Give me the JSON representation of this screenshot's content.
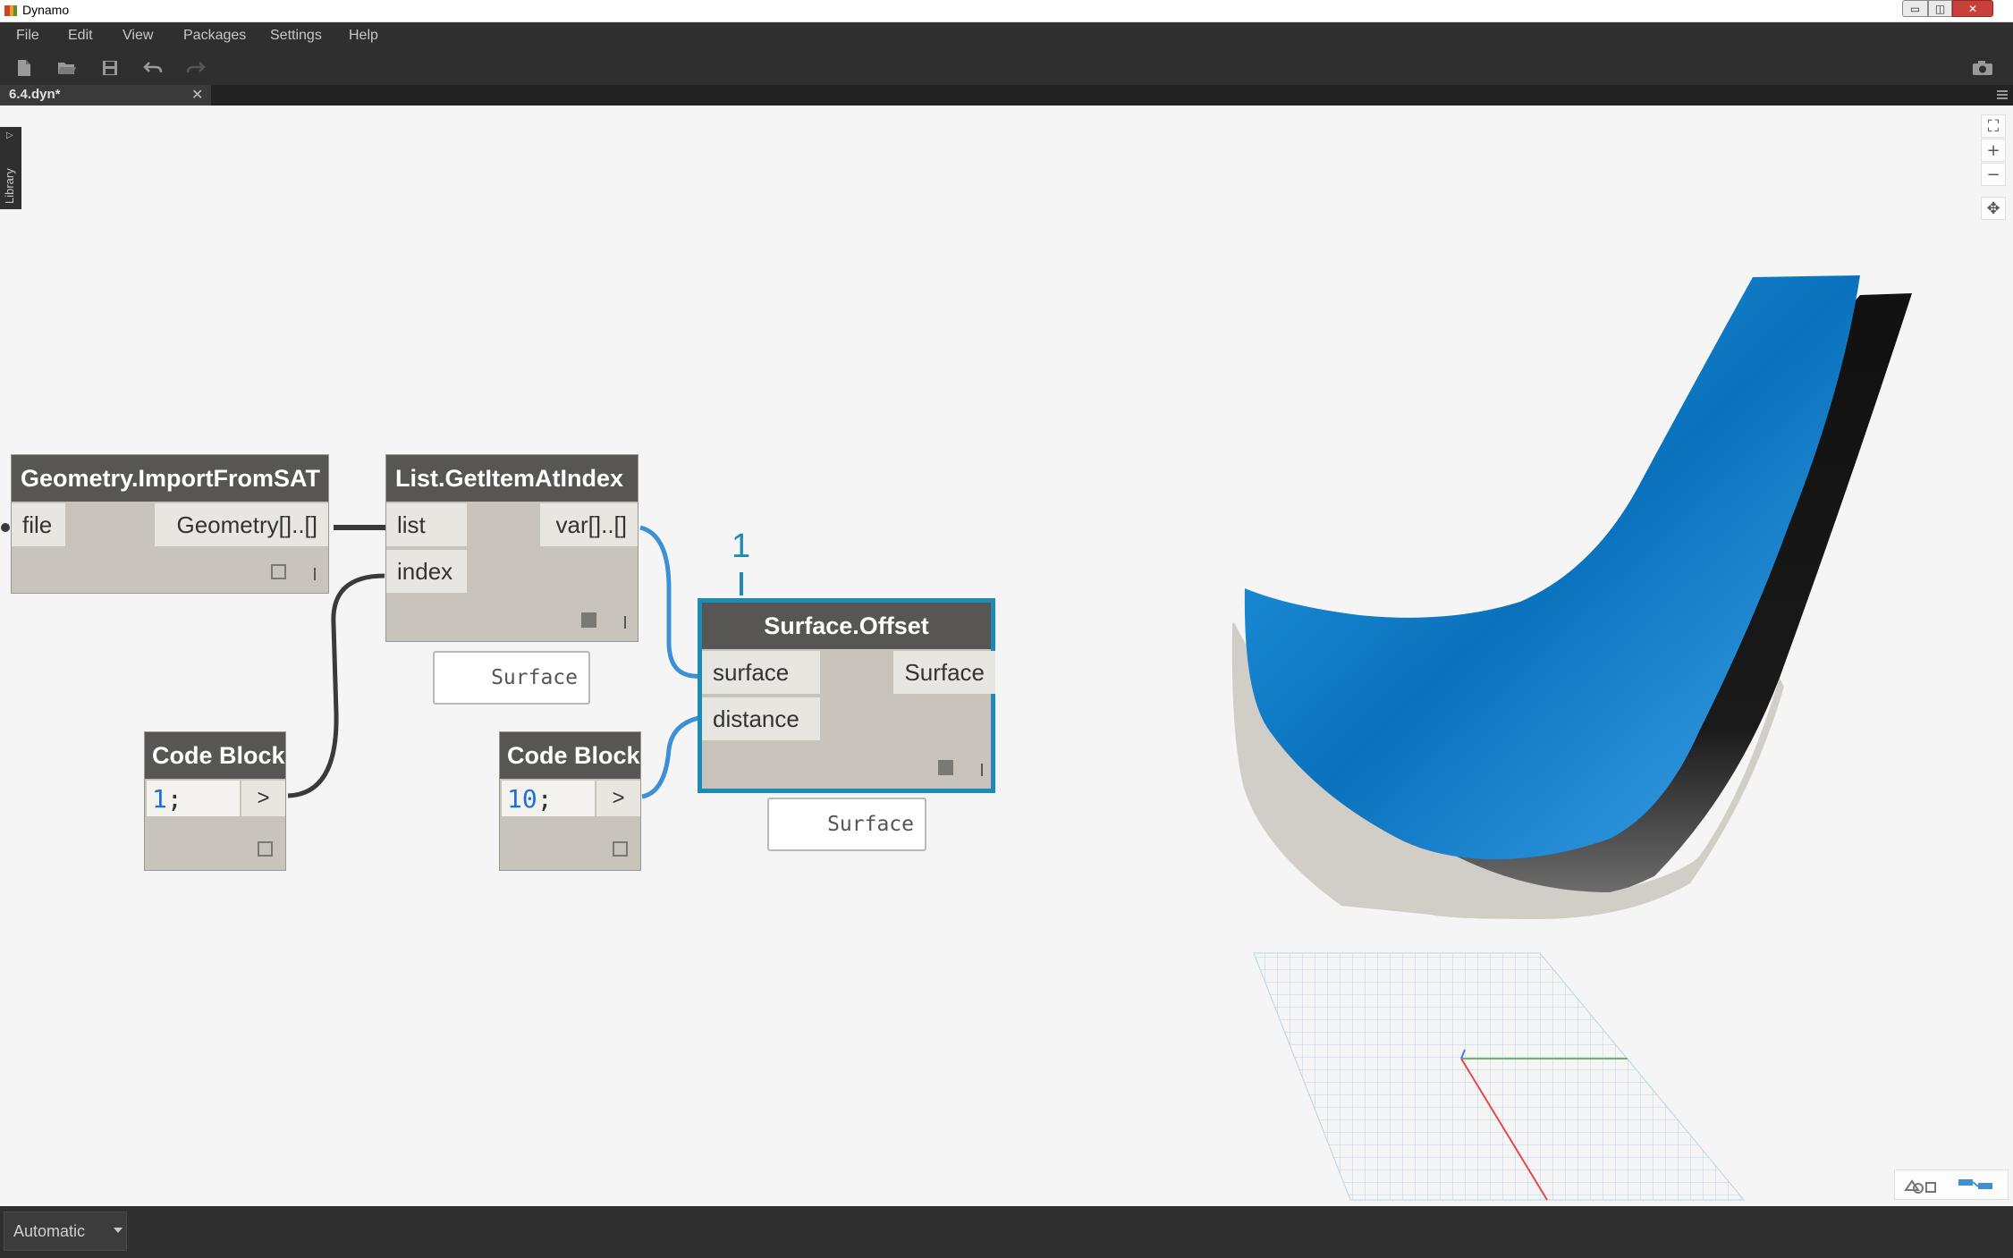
{
  "window": {
    "title": "Dynamo",
    "minimize_glyph": "▭",
    "maximize_glyph": "◫",
    "close_glyph": "✕"
  },
  "menu": {
    "items": [
      "File",
      "Edit",
      "View",
      "Packages",
      "Settings",
      "Help"
    ]
  },
  "toolbar": {
    "icons": [
      "new-file-icon",
      "open-file-icon",
      "save-icon",
      "undo-icon",
      "redo-icon",
      "camera-icon"
    ]
  },
  "tabs": {
    "active_label": "6.4.dyn*",
    "close_glyph": "✕"
  },
  "library": {
    "label": "Library",
    "arrow_glyph": "▷"
  },
  "zoom_controls": {
    "fit_glyph": "⛶",
    "zoom_in_glyph": "+",
    "zoom_out_glyph": "−",
    "pan_glyph": "✥"
  },
  "nodes": {
    "import_sat": {
      "title": "Geometry.ImportFromSAT",
      "input": "file",
      "output": "Geometry[]..[]"
    },
    "get_item": {
      "title": "List.GetItemAtIndex",
      "input_list": "list",
      "input_index": "index",
      "output": "var[]..[]",
      "preview": "Surface"
    },
    "code_block_1": {
      "title": "Code Block",
      "value": "1",
      "semicolon": ";",
      "output": ">"
    },
    "code_block_2": {
      "title": "Code Block",
      "value": "10",
      "semicolon": ";",
      "output": ">"
    },
    "surface_offset": {
      "title": "Surface.Offset",
      "input_surface": "surface",
      "input_distance": "distance",
      "output": "Surface",
      "preview": "Surface"
    }
  },
  "callout": {
    "number": "1"
  },
  "statusbar": {
    "run_mode": "Automatic"
  },
  "colors": {
    "accent": "#1d8ab8",
    "wire_dark": "#3a3a3a",
    "wire_selected": "#3d8fd6",
    "surface_blue": "#1a8fe0",
    "offset_surface": "#1a1a1a"
  }
}
